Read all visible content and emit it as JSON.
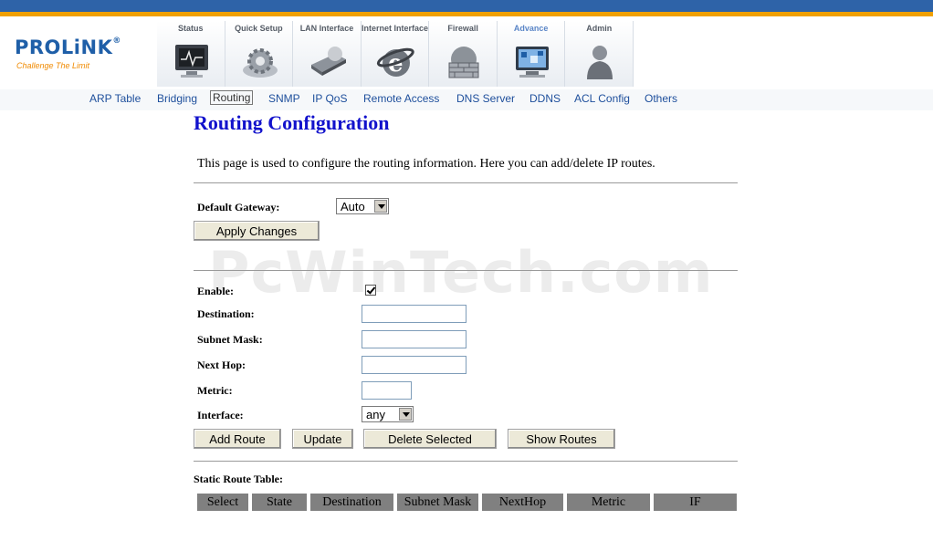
{
  "brand": {
    "name": "PROLiNK",
    "reg": "®",
    "tagline": "Challenge The Limit"
  },
  "tabs": [
    {
      "label": "Status",
      "icon": "monitor-icon"
    },
    {
      "label": "Quick Setup",
      "icon": "gear-icon"
    },
    {
      "label": "LAN Interface",
      "icon": "drive-icon"
    },
    {
      "label": "Internet Interface",
      "icon": "internet-explorer-icon"
    },
    {
      "label": "Firewall",
      "icon": "firewall-icon"
    },
    {
      "label": "Advance",
      "icon": "advance-icon",
      "active": true
    },
    {
      "label": "Admin",
      "icon": "admin-user-icon"
    }
  ],
  "subnav": [
    "ARP Table",
    "Bridging",
    "Routing",
    "SNMP",
    "IP QoS",
    "Remote Access",
    "DNS Server",
    "DDNS",
    "ACL Config",
    "Others"
  ],
  "subnav_active": "Routing",
  "page": {
    "title": "Routing Configuration",
    "description": "This page is used to configure the routing information. Here you can add/delete IP routes."
  },
  "gateway": {
    "label": "Default Gateway:",
    "value": "Auto",
    "apply_label": "Apply Changes"
  },
  "route_form": {
    "enable_label": "Enable:",
    "enable_checked": true,
    "destination_label": "Destination:",
    "subnet_label": "Subnet Mask:",
    "nexthop_label": "Next Hop:",
    "metric_label": "Metric:",
    "interface_label": "Interface:",
    "interface_value": "any",
    "destination_value": "",
    "subnet_value": "",
    "nexthop_value": "",
    "metric_value": ""
  },
  "buttons": {
    "add": "Add Route",
    "update": "Update",
    "delete": "Delete Selected",
    "show": "Show Routes"
  },
  "table": {
    "title": "Static Route Table:",
    "columns": [
      "Select",
      "State",
      "Destination",
      "Subnet Mask",
      "NextHop",
      "Metric",
      "IF"
    ]
  },
  "watermark": "PcWinTech.com",
  "colors": {
    "title_blue": "#1212cc",
    "nav_blue": "#1e4f9c",
    "header_bar": "#2e63a8",
    "accent_orange": "#f0a000",
    "table_head": "#808080"
  }
}
